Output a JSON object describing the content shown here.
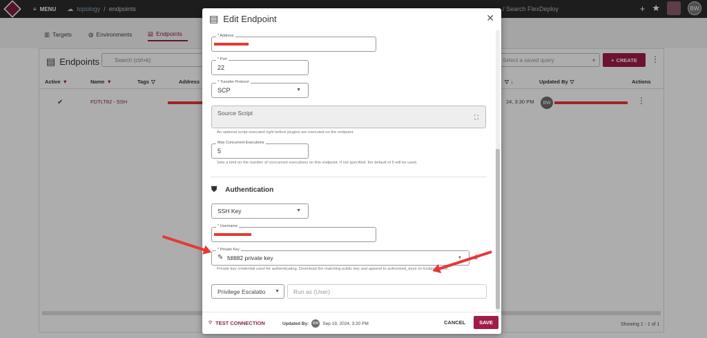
{
  "topbar": {
    "menu_label": "MENU",
    "crumb_1": "topology",
    "crumb_sep": "/",
    "crumb_2": "endpoints",
    "search_placeholder": "/ Search FlexDeploy",
    "user_initials": "BW"
  },
  "tabs": [
    {
      "label": "Targets"
    },
    {
      "label": "Environments"
    },
    {
      "label": "Endpoints"
    }
  ],
  "card": {
    "title": "Endpoints",
    "search_placeholder": "Search (ctrl+k)",
    "saved_query_placeholder": "Select a saved query",
    "create_label": "CREATE",
    "columns": {
      "active": "Active",
      "name": "Name",
      "tags": "Tags",
      "address": "Address",
      "updated_by": "Updated By",
      "actions": "Actions"
    },
    "row": {
      "name": "FDTLT82 - SSH",
      "updated_on_partial": "24, 3:30 PM",
      "updated_by_initials": "BW"
    },
    "footer": "Showing 1 - 1 of 1"
  },
  "modal": {
    "title": "Edit Endpoint",
    "address_label": "* Address",
    "port_label": "* Port",
    "port_value": "22",
    "protocol_label": "* Transfer Protocol",
    "protocol_value": "SCP",
    "source_script_label": "Source Script",
    "source_script_hint": "An optional script executed right before plugins are executed on the endpoint.",
    "max_exec_label": "Max Concurrent Executions",
    "max_exec_value": "5",
    "max_exec_hint": "Sets a limit on the number of concurrent executions on this endpoint. If not specified, the default of 5 will be used.",
    "auth_heading": "Authentication",
    "auth_type_value": "SSH Key",
    "username_label": "* Username",
    "private_key_label": "* Private Key",
    "private_key_value": "fdtlt82 private key",
    "private_key_hint": "Private key credential used for authenticating.  Download the matching public key and append to authorized_keys on Endpoint host.",
    "priv_esc_value": "Privilege Escalatio",
    "run_as_placeholder": "Run as (User)",
    "test_connection_label": "TEST CONNECTION",
    "updated_by_label": "Updated By:",
    "updated_by_initials": "BW",
    "updated_on": "Sep 19, 2024, 3:30 PM",
    "cancel_label": "CANCEL",
    "save_label": "SAVE"
  },
  "colors": {
    "accent": "#a01d48",
    "annotation_red": "#e53935"
  }
}
